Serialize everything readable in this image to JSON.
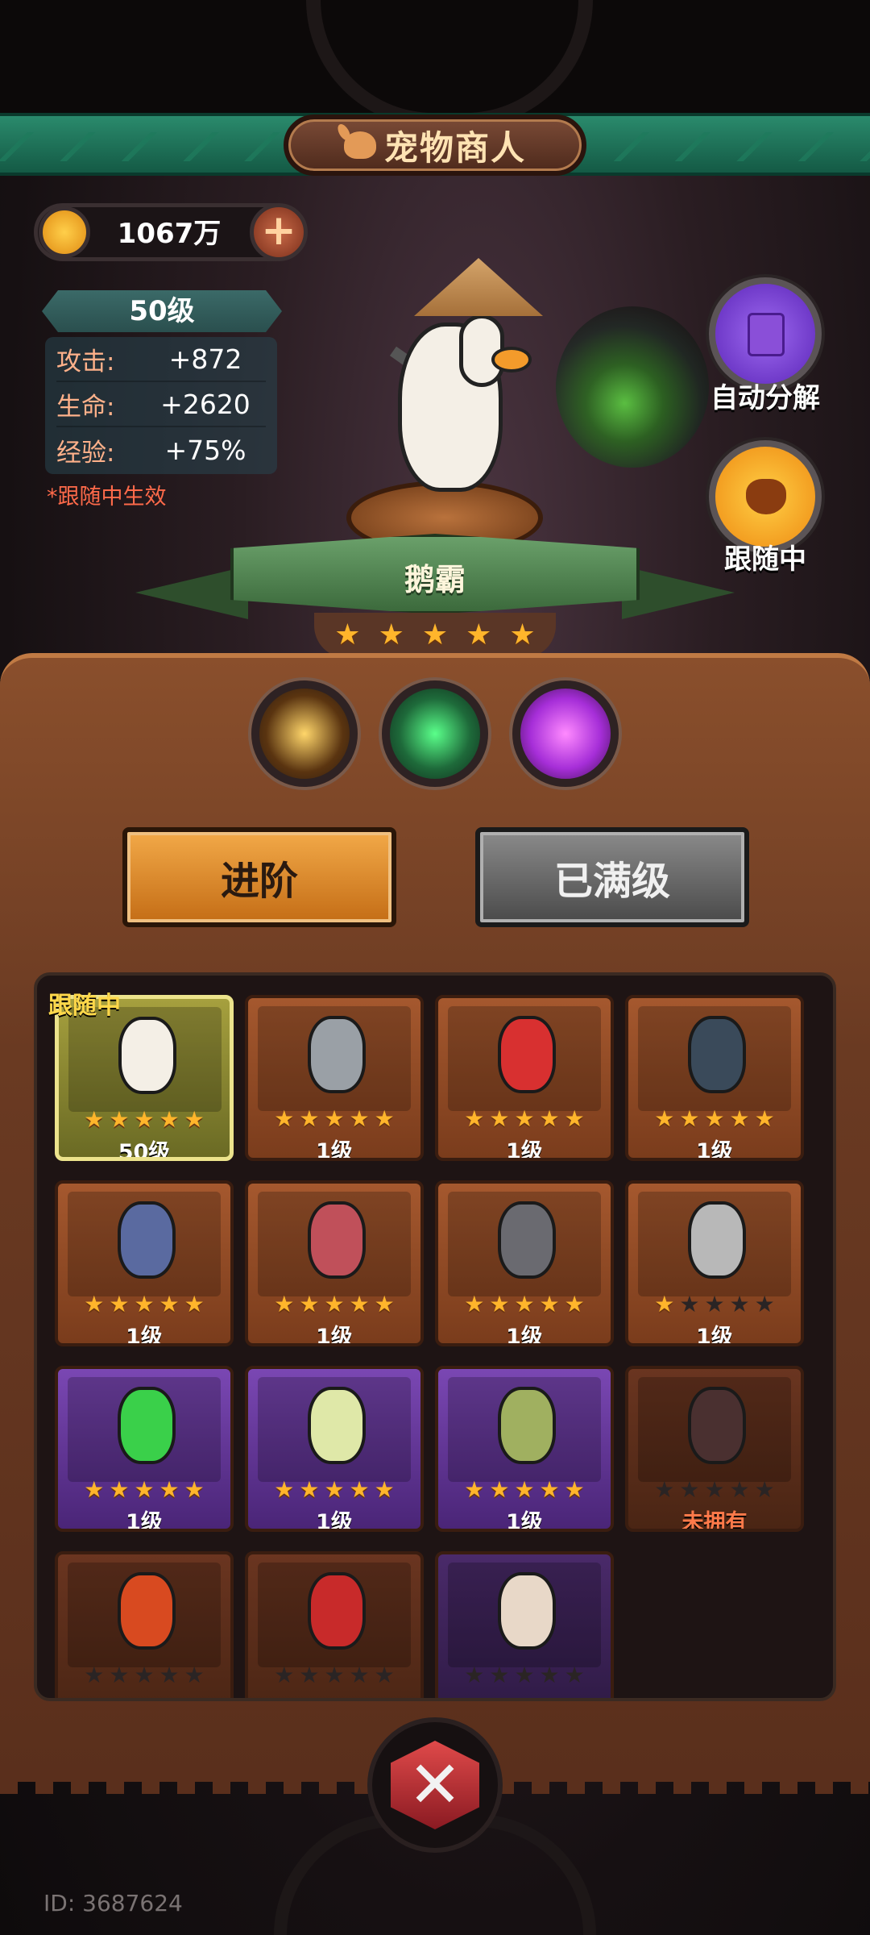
{
  "header": {
    "title": "宠物商人"
  },
  "currency": {
    "amount": "1067万"
  },
  "pet_stats": {
    "level": "50级",
    "rows": [
      {
        "label": "攻击:",
        "value": "+872"
      },
      {
        "label": "生命:",
        "value": "+2620"
      },
      {
        "label": "经验:",
        "value": "+75%"
      }
    ],
    "note": "*跟随中生效"
  },
  "side_buttons": {
    "auto_decompose": "自动分解",
    "following": "跟随中"
  },
  "selected_pet": {
    "name": "鹅霸",
    "stars": 5
  },
  "actions": {
    "advance": "进阶",
    "maxed": "已满级"
  },
  "grid": {
    "following_tag": "跟随中",
    "pets": [
      {
        "level": "50级",
        "stars": 5,
        "rarity": "selected",
        "color": "#f4efe6"
      },
      {
        "level": "1级",
        "stars": 5,
        "rarity": "orange",
        "color": "#9aa0a6"
      },
      {
        "level": "1级",
        "stars": 5,
        "rarity": "orange",
        "color": "#d83030"
      },
      {
        "level": "1级",
        "stars": 5,
        "rarity": "orange",
        "color": "#3a4a5a"
      },
      {
        "level": "1级",
        "stars": 5,
        "rarity": "orange",
        "color": "#5a6aa0"
      },
      {
        "level": "1级",
        "stars": 5,
        "rarity": "orange",
        "color": "#c0505a"
      },
      {
        "level": "1级",
        "stars": 5,
        "rarity": "orange",
        "color": "#6a6a70"
      },
      {
        "level": "1级",
        "stars": 1,
        "rarity": "orange",
        "color": "#b8b8b8"
      },
      {
        "level": "1级",
        "stars": 5,
        "rarity": "purple",
        "color": "#3ad04a"
      },
      {
        "level": "1级",
        "stars": 5,
        "rarity": "purple",
        "color": "#dfe8a8"
      },
      {
        "level": "1级",
        "stars": 5,
        "rarity": "purple",
        "color": "#a0b060"
      },
      {
        "level": "未拥有",
        "stars": 0,
        "rarity": "dim",
        "color": "#4a3030"
      },
      {
        "level": "",
        "stars": 0,
        "rarity": "dim",
        "color": "#d84a20"
      },
      {
        "level": "",
        "stars": 0,
        "rarity": "dim",
        "color": "#c82a2a"
      },
      {
        "level": "",
        "stars": 0,
        "rarity": "dim-purple",
        "color": "#e8d8c8"
      }
    ]
  },
  "footer": {
    "uid": "ID: 3687624"
  }
}
